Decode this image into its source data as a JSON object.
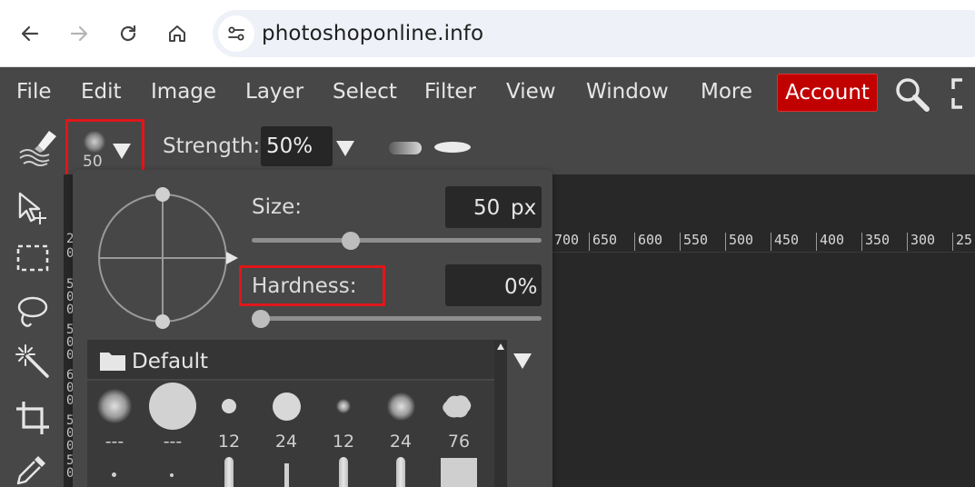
{
  "browser": {
    "url": "photoshoponline.info"
  },
  "menu": {
    "items": [
      "File",
      "Edit",
      "Image",
      "Layer",
      "Select",
      "Filter",
      "View",
      "Window",
      "More"
    ],
    "account": "Account"
  },
  "options": {
    "brush_size_preview": "50",
    "strength_label": "Strength:",
    "strength_value": "50%"
  },
  "ruler": {
    "labels": [
      "700",
      "650",
      "600",
      "550",
      "500",
      "450",
      "400",
      "350",
      "300",
      "25"
    ],
    "vertical_digits": [
      "2",
      "0",
      "5",
      "0",
      "0",
      "5",
      "0",
      "0",
      "6",
      "0",
      "0",
      "5",
      "0",
      "0",
      "5",
      "0",
      "0",
      "4",
      "0"
    ]
  },
  "brush_popup": {
    "size_label": "Size:",
    "size_value": "50",
    "size_unit": "px",
    "size_fraction": 0.33,
    "hardness_label": "Hardness:",
    "hardness_value": "0%",
    "hardness_fraction": 0.0,
    "folder_label": "Default",
    "brushes": [
      {
        "label": "---",
        "kind": "soft-small"
      },
      {
        "label": "---",
        "kind": "hard-large"
      },
      {
        "label": "12",
        "kind": "hard-tiny"
      },
      {
        "label": "24",
        "kind": "hard-medium"
      },
      {
        "label": "12",
        "kind": "soft-tiny"
      },
      {
        "label": "24",
        "kind": "soft-medium"
      },
      {
        "label": "76",
        "kind": "splatter"
      }
    ]
  },
  "icons": {
    "back": "arrow-left-icon",
    "forward": "arrow-right-icon",
    "reload": "reload-icon",
    "home": "home-icon",
    "site_info": "tune-icon",
    "search": "magnifier-icon",
    "fullscreen": "fullscreen-icon"
  },
  "colors": {
    "app_bg": "#474747",
    "account_red": "#c10000",
    "highlight_red": "#e0161b",
    "canvas_bg": "#282828"
  }
}
